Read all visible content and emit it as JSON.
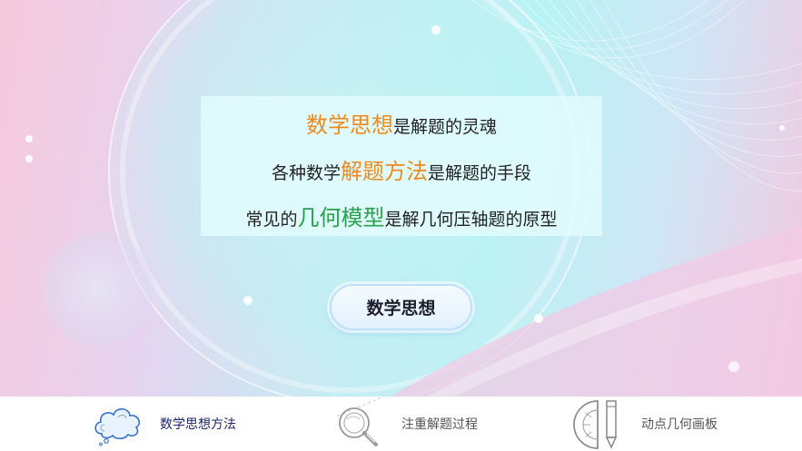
{
  "headline": {
    "line1": {
      "highlight": "数学思想",
      "rest": "是解题的灵魂"
    },
    "line2": {
      "prefix": "各种数学",
      "highlight": "解题方法",
      "rest": "是解题的手段"
    },
    "line3": {
      "prefix": "常见的",
      "highlight": "几何模型",
      "rest": "是解几何压轴题的原型"
    }
  },
  "main_button": {
    "label": "数学思想"
  },
  "nav": {
    "items": [
      {
        "label": "数学思想方法",
        "icon": "cloud-icon",
        "active": true
      },
      {
        "label": "注重解题过程",
        "icon": "magnifier-icon",
        "active": false
      },
      {
        "label": "动点几何画板",
        "icon": "protractor-pencil-icon",
        "active": false
      }
    ]
  },
  "colors": {
    "highlight_orange": "#f08a1e",
    "highlight_green": "#2aa14b",
    "nav_active": "#1f2a6e",
    "nav_inactive": "#555555"
  }
}
